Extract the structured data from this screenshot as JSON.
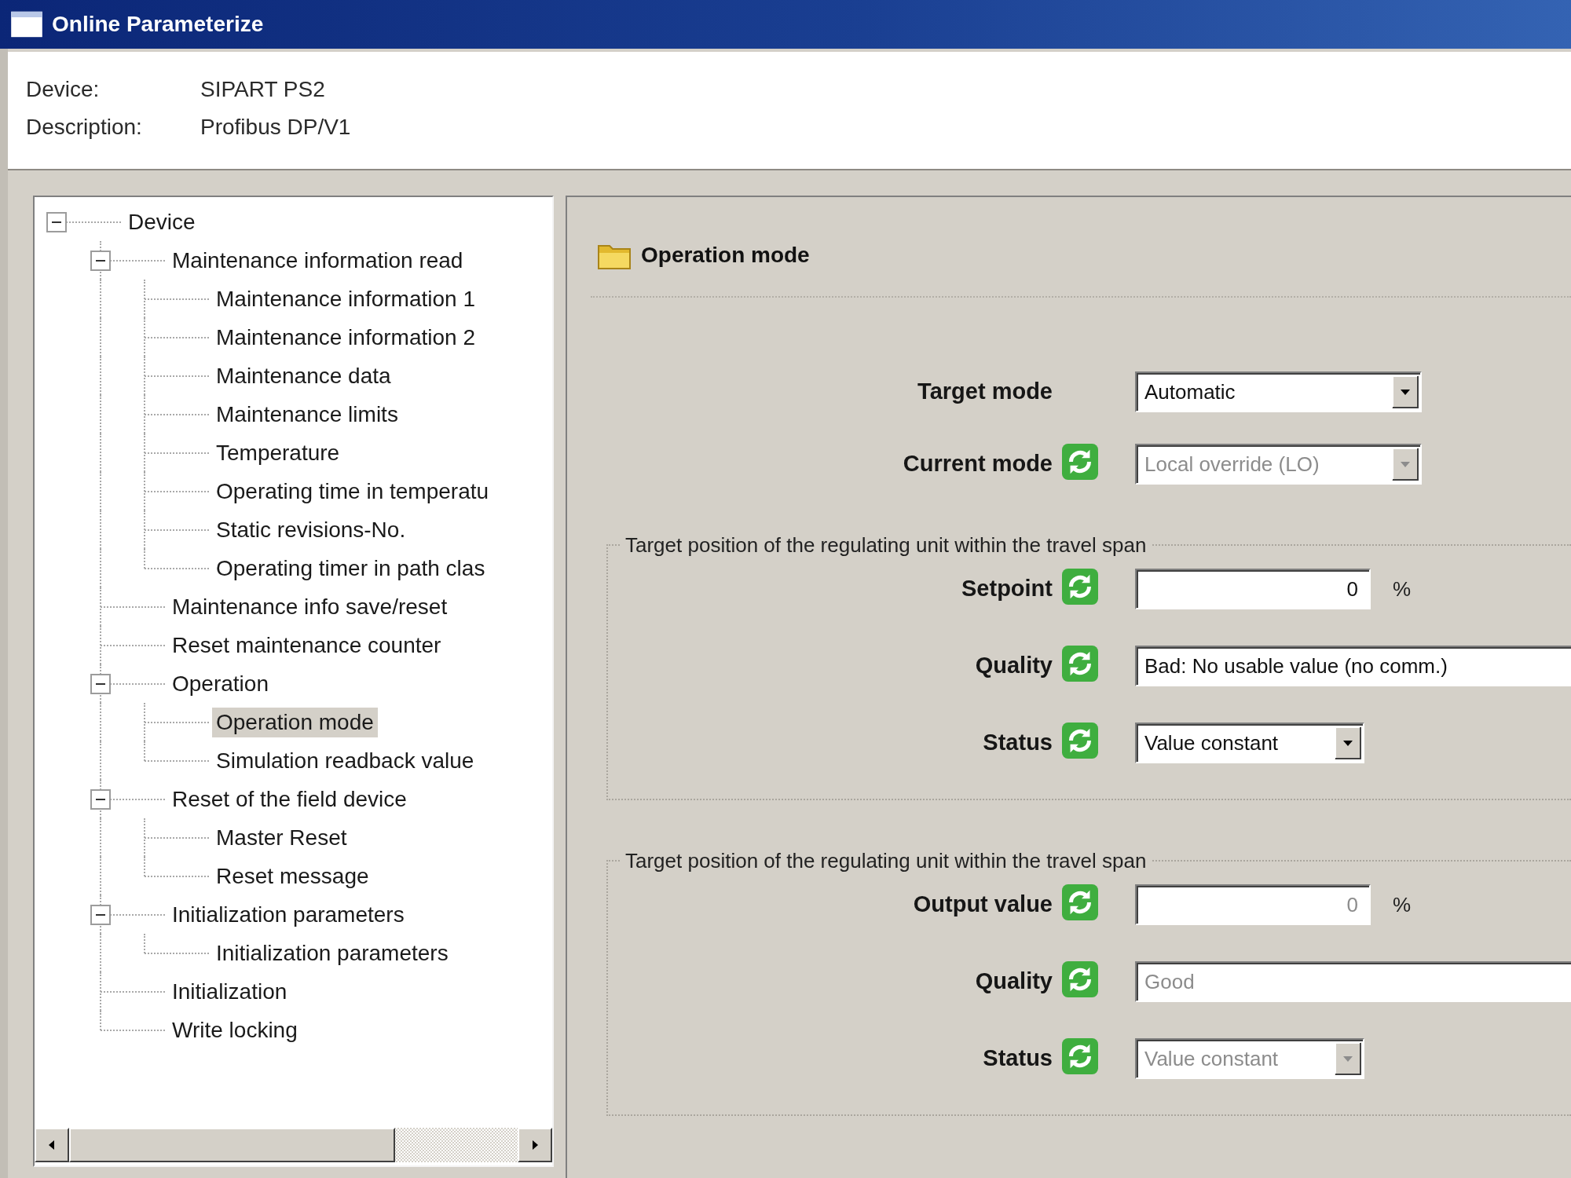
{
  "window": {
    "title": "Online Parameterize"
  },
  "device_info": [
    {
      "label": "Device:",
      "value": "SIPART PS2"
    },
    {
      "label": "Description:",
      "value": "Profibus DP/V1"
    }
  ],
  "navigation_tree": [
    {
      "label": "Device",
      "expanded": true,
      "selected": false,
      "children": [
        {
          "label": "Maintenance information read",
          "expanded": true,
          "selected": false,
          "children": [
            {
              "label": "Maintenance information 1",
              "selected": false
            },
            {
              "label": "Maintenance information 2",
              "selected": false
            },
            {
              "label": "Maintenance data",
              "selected": false
            },
            {
              "label": "Maintenance limits",
              "selected": false
            },
            {
              "label": "Temperature",
              "selected": false
            },
            {
              "label": "Operating time in temperatu",
              "selected": false
            },
            {
              "label": "Static revisions-No.",
              "selected": false
            },
            {
              "label": "Operating timer in path clas",
              "selected": false
            }
          ]
        },
        {
          "label": "Maintenance info save/reset",
          "selected": false
        },
        {
          "label": "Reset maintenance counter",
          "selected": false
        },
        {
          "label": "Operation",
          "expanded": true,
          "selected": false,
          "children": [
            {
              "label": "Operation mode",
              "selected": true
            },
            {
              "label": "Simulation readback value",
              "selected": false
            }
          ]
        },
        {
          "label": "Reset of the field device",
          "expanded": true,
          "selected": false,
          "children": [
            {
              "label": "Master Reset",
              "selected": false
            },
            {
              "label": "Reset message",
              "selected": false
            }
          ]
        },
        {
          "label": "Initialization parameters",
          "expanded": true,
          "selected": false,
          "children": [
            {
              "label": "Initialization parameters",
              "selected": false
            }
          ]
        },
        {
          "label": "Initialization",
          "selected": false
        },
        {
          "label": "Write locking",
          "selected": false
        }
      ]
    }
  ],
  "parameter_panel": {
    "title": "Operation mode",
    "fields": [
      {
        "label": "Target mode",
        "kind": "dropdown",
        "value": "Automatic",
        "disabled": false,
        "refresh_icon": false
      },
      {
        "label": "Current mode",
        "kind": "dropdown",
        "value": "Local override (LO)",
        "disabled": true,
        "refresh_icon": true
      }
    ],
    "groups": [
      {
        "legend": "Target position of the regulating unit within the travel span",
        "fields": [
          {
            "label": "Setpoint",
            "kind": "number",
            "value": "0",
            "unit": "%",
            "disabled": false,
            "refresh_icon": true
          },
          {
            "label": "Quality",
            "kind": "text",
            "value": "Bad: No usable value (no comm.)",
            "disabled": false,
            "refresh_icon": true
          },
          {
            "label": "Status",
            "kind": "dropdown",
            "value": "Value constant",
            "disabled": false,
            "refresh_icon": true
          }
        ]
      },
      {
        "legend": "Target position of the regulating unit within the travel span",
        "fields": [
          {
            "label": "Output value",
            "kind": "number",
            "value": "0",
            "unit": "%",
            "disabled": true,
            "refresh_icon": true
          },
          {
            "label": "Quality",
            "kind": "text",
            "value": "Good",
            "disabled": true,
            "refresh_icon": true
          },
          {
            "label": "Status",
            "kind": "dropdown",
            "value": "Value constant",
            "disabled": true,
            "refresh_icon": true
          }
        ]
      }
    ]
  }
}
